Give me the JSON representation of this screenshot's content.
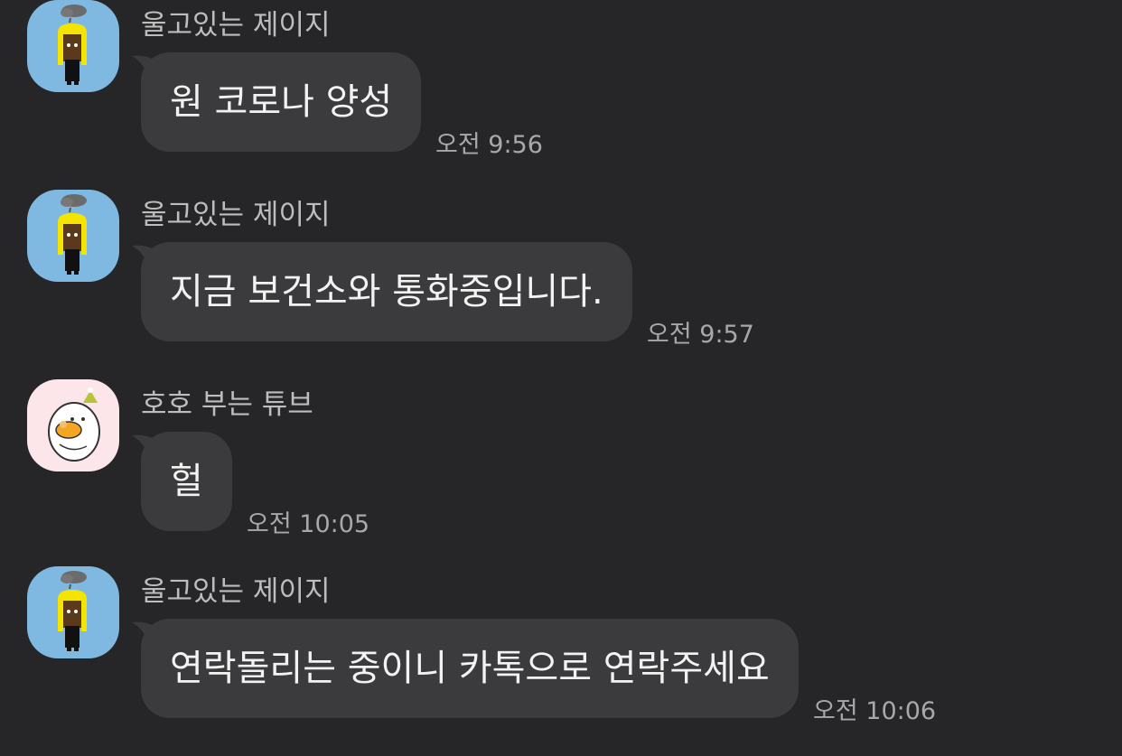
{
  "messages": [
    {
      "sender": "울고있는 제이지",
      "text": "원 코로나 양성",
      "time": "오전 9:56",
      "avatar": "jay-g-avatar"
    },
    {
      "sender": "울고있는 제이지",
      "text": "지금 보건소와 통화중입니다.",
      "time": "오전 9:57",
      "avatar": "jay-g-avatar"
    },
    {
      "sender": "호호 부는 튜브",
      "text": "헐",
      "time": "오전 10:05",
      "avatar": "tube-avatar"
    },
    {
      "sender": "울고있는 제이지",
      "text": "연락돌리는 중이니 카톡으로 연락주세요",
      "time": "오전 10:06",
      "avatar": "jay-g-avatar"
    }
  ],
  "colors": {
    "background": "#262628",
    "bubble": "#3b3b3d",
    "sender_text": "#bdbdbd",
    "time_text": "#a8a8a8",
    "jay_g_avatar_bg": "#7fb8e0",
    "tube_avatar_bg": "#fde6ea"
  }
}
